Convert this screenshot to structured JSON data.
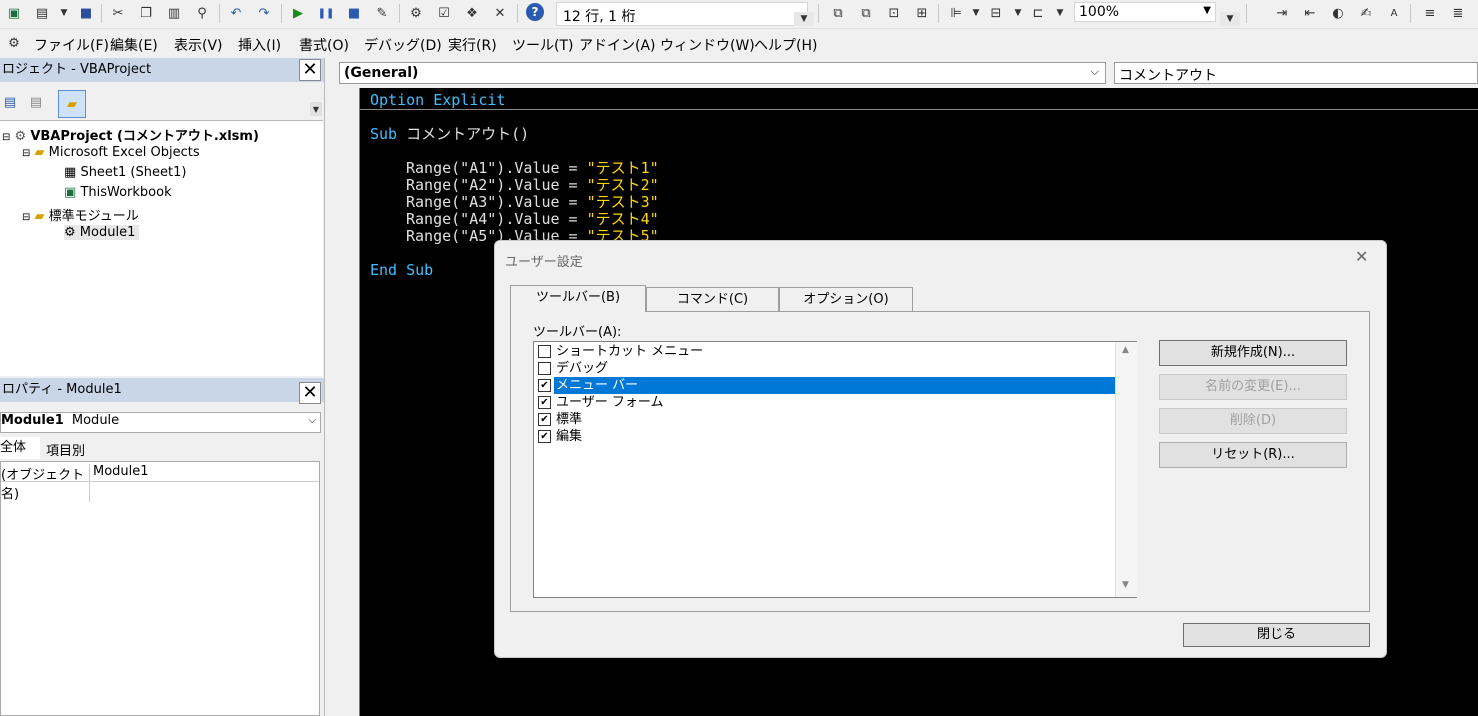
{
  "toolbar": {
    "position_status": "12 行, 1 桁",
    "zoom": "100%"
  },
  "menu": [
    "ファイル(F)",
    "編集(E)",
    "表示(V)",
    "挿入(I)",
    "書式(O)",
    "デバッグ(D)",
    "実行(R)",
    "ツール(T)",
    "アドイン(A)",
    "ウィンドウ(W)",
    "ヘルプ(H)"
  ],
  "project_panel": {
    "title": "ロジェクト - VBAProject",
    "close": "✕",
    "tree": {
      "root": "VBAProject (コメントアウト.xlsm)",
      "excel_objects": "Microsoft Excel Objects",
      "sheet1": "Sheet1 (Sheet1)",
      "workbook": "ThisWorkbook",
      "modules_folder": "標準モジュール",
      "module1": "Module1"
    }
  },
  "properties_panel": {
    "title": "ロパティ - Module1",
    "close": "✕",
    "object_name": "Module1",
    "object_type": "Module",
    "tab_all": "全体",
    "tab_category": "項目別",
    "prop_name": "(オブジェクト名)",
    "prop_value": "Module1"
  },
  "code_window": {
    "object_combo": "(General)",
    "proc_combo": "コメントアウト",
    "lines": {
      "l1": "Option Explicit",
      "l2_kw": "Sub",
      "l2_txt": " コメントアウト()",
      "r1_a": "Range(\"A1\").Value = ",
      "r1_b": "\"テスト1\"",
      "r2_a": "Range(\"A2\").Value = ",
      "r2_b": "\"テスト2\"",
      "r3_a": "Range(\"A3\").Value = ",
      "r3_b": "\"テスト3\"",
      "r4_a": "Range(\"A4\").Value = ",
      "r4_b": "\"テスト4\"",
      "r5_a": "Range(\"A5\").Value = ",
      "r5_b": "\"テスト5\"",
      "end": "End Sub"
    }
  },
  "dialog": {
    "title": "ユーザー設定",
    "close": "✕",
    "tabs": [
      "ツールバー(B)",
      "コマンド(C)",
      "オプション(O)"
    ],
    "list_label": "ツールバー(A):",
    "toolbars": [
      {
        "label": "ショートカット メニュー",
        "checked": false
      },
      {
        "label": "デバッグ",
        "checked": false
      },
      {
        "label": "メニュー バー",
        "checked": true
      },
      {
        "label": "ユーザー フォーム",
        "checked": true
      },
      {
        "label": "標準",
        "checked": true
      },
      {
        "label": "編集",
        "checked": true
      }
    ],
    "buttons": {
      "new": "新規作成(N)...",
      "rename": "名前の変更(E)...",
      "delete": "削除(D)",
      "reset": "リセット(R)..."
    },
    "close_button": "閉じる",
    "colors": {
      "selection": "#0078d7"
    }
  }
}
